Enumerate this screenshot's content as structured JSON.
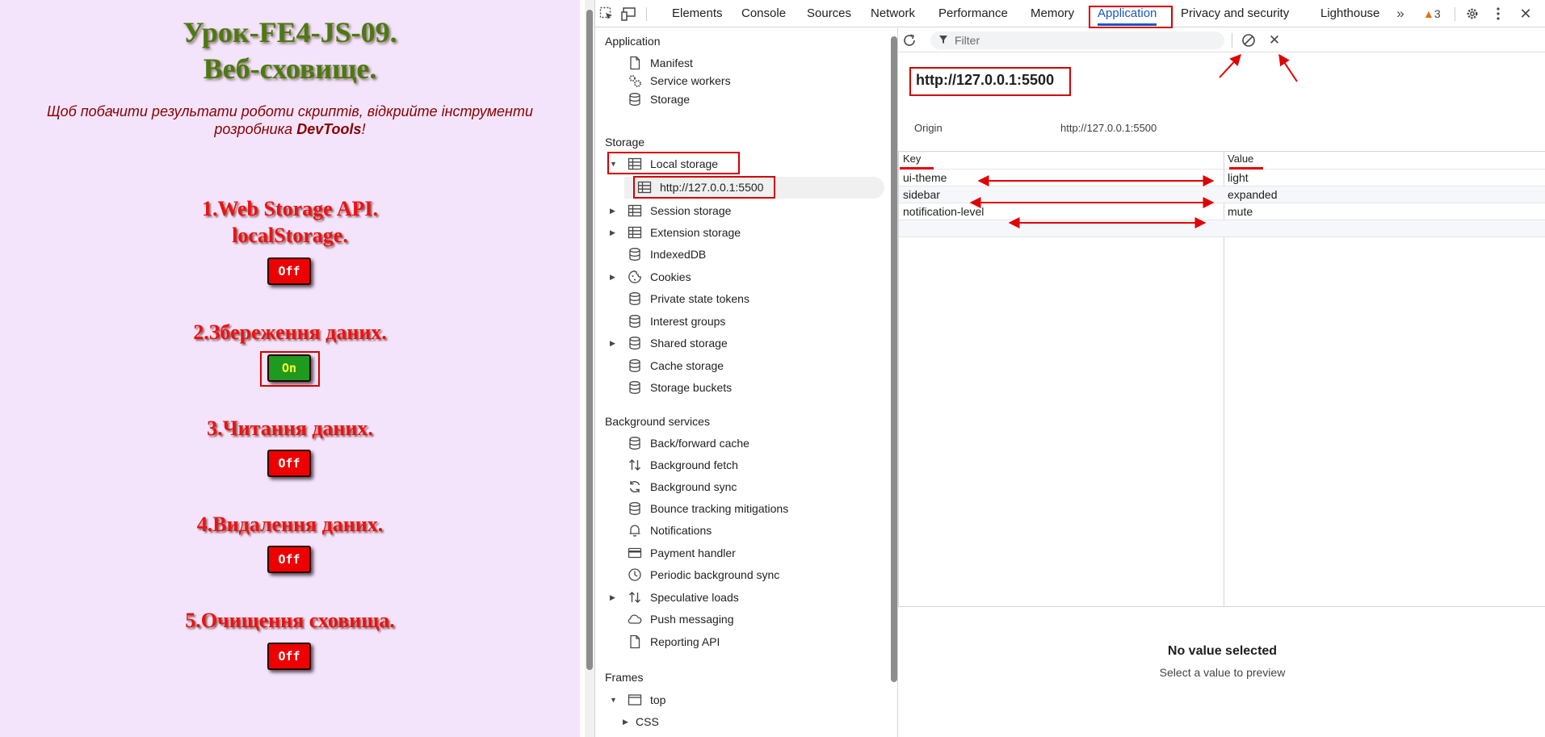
{
  "webpage": {
    "title_line1": "Урок-FE4-JS-09.",
    "title_line2": "Веб-сховище.",
    "note": "Щоб побачити результати роботи скриптів, відкрийте інструменти розробника",
    "note_bold": "DevTools",
    "note_end": "!",
    "lessons": [
      {
        "line1": "1.Web Storage API.",
        "line2": "localStorage.",
        "button": "Off",
        "state": "off"
      },
      {
        "line1": "2.Збереження даних.",
        "button": "On",
        "state": "on"
      },
      {
        "line1": "3.Читання даних.",
        "button": "Off",
        "state": "off"
      },
      {
        "line1": "4.Видалення даних.",
        "button": "Off",
        "state": "off"
      },
      {
        "line1": "5.Очищення сховища.",
        "button": "Off",
        "state": "off"
      }
    ]
  },
  "devtools": {
    "tabs": [
      "Elements",
      "Console",
      "Sources",
      "Network",
      "Performance",
      "Memory",
      "Application",
      "Privacy and security",
      "Lighthouse"
    ],
    "active_tab": "Application",
    "warnings_count": "3",
    "sidebar": {
      "application_header": "Application",
      "application_items": [
        "Manifest",
        "Service workers",
        "Storage"
      ],
      "storage_header": "Storage",
      "storage_items": [
        "Local storage",
        "http://127.0.0.1:5500",
        "Session storage",
        "Extension storage",
        "IndexedDB",
        "Cookies",
        "Private state tokens",
        "Interest groups",
        "Shared storage",
        "Cache storage",
        "Storage buckets"
      ],
      "background_header": "Background services",
      "background_items": [
        "Back/forward cache",
        "Background fetch",
        "Background sync",
        "Bounce tracking mitigations",
        "Notifications",
        "Payment handler",
        "Periodic background sync",
        "Speculative loads",
        "Push messaging",
        "Reporting API"
      ],
      "frames_header": "Frames",
      "frames_items": [
        "top",
        "CSS"
      ]
    },
    "main": {
      "filter_placeholder": "Filter",
      "origin_title": "http://127.0.0.1:5500",
      "origin_label": "Origin",
      "origin_value": "http://127.0.0.1:5500",
      "columns": [
        "Key",
        "Value"
      ],
      "rows": [
        {
          "key": "ui-theme",
          "value": "light"
        },
        {
          "key": "sidebar",
          "value": "expanded"
        },
        {
          "key": "notification-level",
          "value": "mute"
        }
      ],
      "preview_title": "No value selected",
      "preview_subtitle": "Select a value to preview"
    }
  },
  "colors": {
    "annotation": "#d40000",
    "accent": "#1a56c6",
    "page_bg": "#f3e4fb"
  }
}
